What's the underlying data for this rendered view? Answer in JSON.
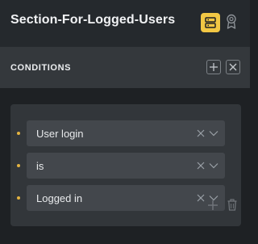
{
  "header": {
    "title": "Section-For-Logged-Users",
    "icons": {
      "layout": "layout-rows-icon",
      "award": "award-icon"
    }
  },
  "conditions": {
    "title": "CONDITIONS",
    "icons": {
      "add": "plus-box-icon",
      "close": "close-box-icon"
    },
    "rows": [
      {
        "value": "User login"
      },
      {
        "value": "is"
      },
      {
        "value": "Logged in"
      }
    ],
    "footer_icons": {
      "add": "plus-icon",
      "delete": "trash-icon"
    }
  },
  "colors": {
    "accent": "#f2c744",
    "bullet": "#e3b341",
    "background": "#1e2124",
    "header_bg": "#25292d",
    "bar_bg": "#34383c",
    "panel_bg": "#32363a",
    "select_bg": "#43474c"
  }
}
